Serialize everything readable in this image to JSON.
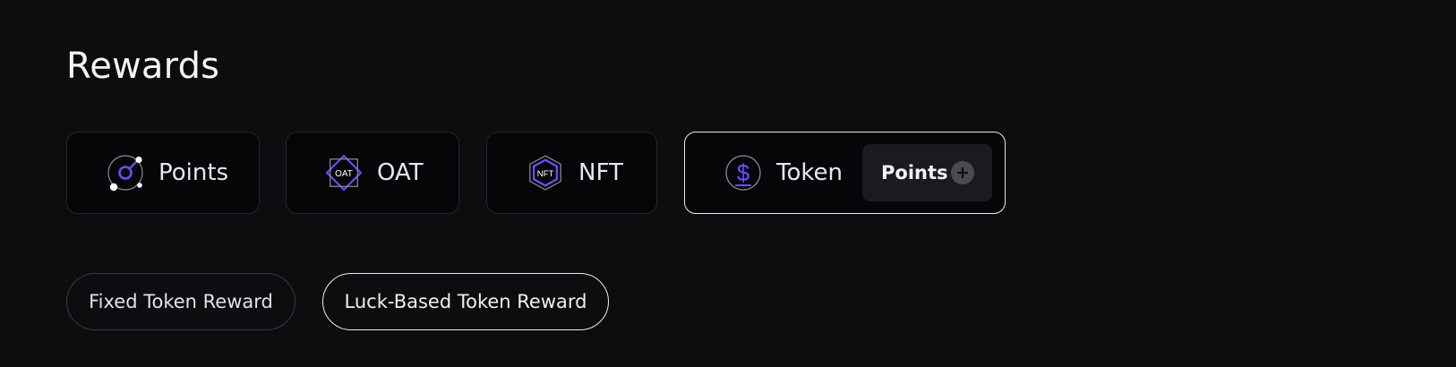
{
  "page": {
    "title": "Rewards"
  },
  "reward_types": [
    {
      "label": "Points",
      "icon": "orbit-icon",
      "selected": false
    },
    {
      "label": "OAT",
      "icon": "oat-badge-icon",
      "icon_text": "OAT",
      "selected": false
    },
    {
      "label": "NFT",
      "icon": "nft-hexagon-icon",
      "icon_text": "NFT",
      "selected": false
    },
    {
      "label": "Token",
      "icon": "dollar-coin-icon",
      "selected": true
    }
  ],
  "token_sub_option": {
    "label": "Points",
    "icon": "plus-circle-icon"
  },
  "reward_modes": [
    {
      "label": "Fixed Token Reward",
      "active": false
    },
    {
      "label": "Luck-Based Token Reward",
      "active": true
    }
  ],
  "colors": {
    "background": "#0d0d0f",
    "card_background": "#060608",
    "accent": "#6b4cff",
    "selected_border": "#e9e9ee"
  }
}
